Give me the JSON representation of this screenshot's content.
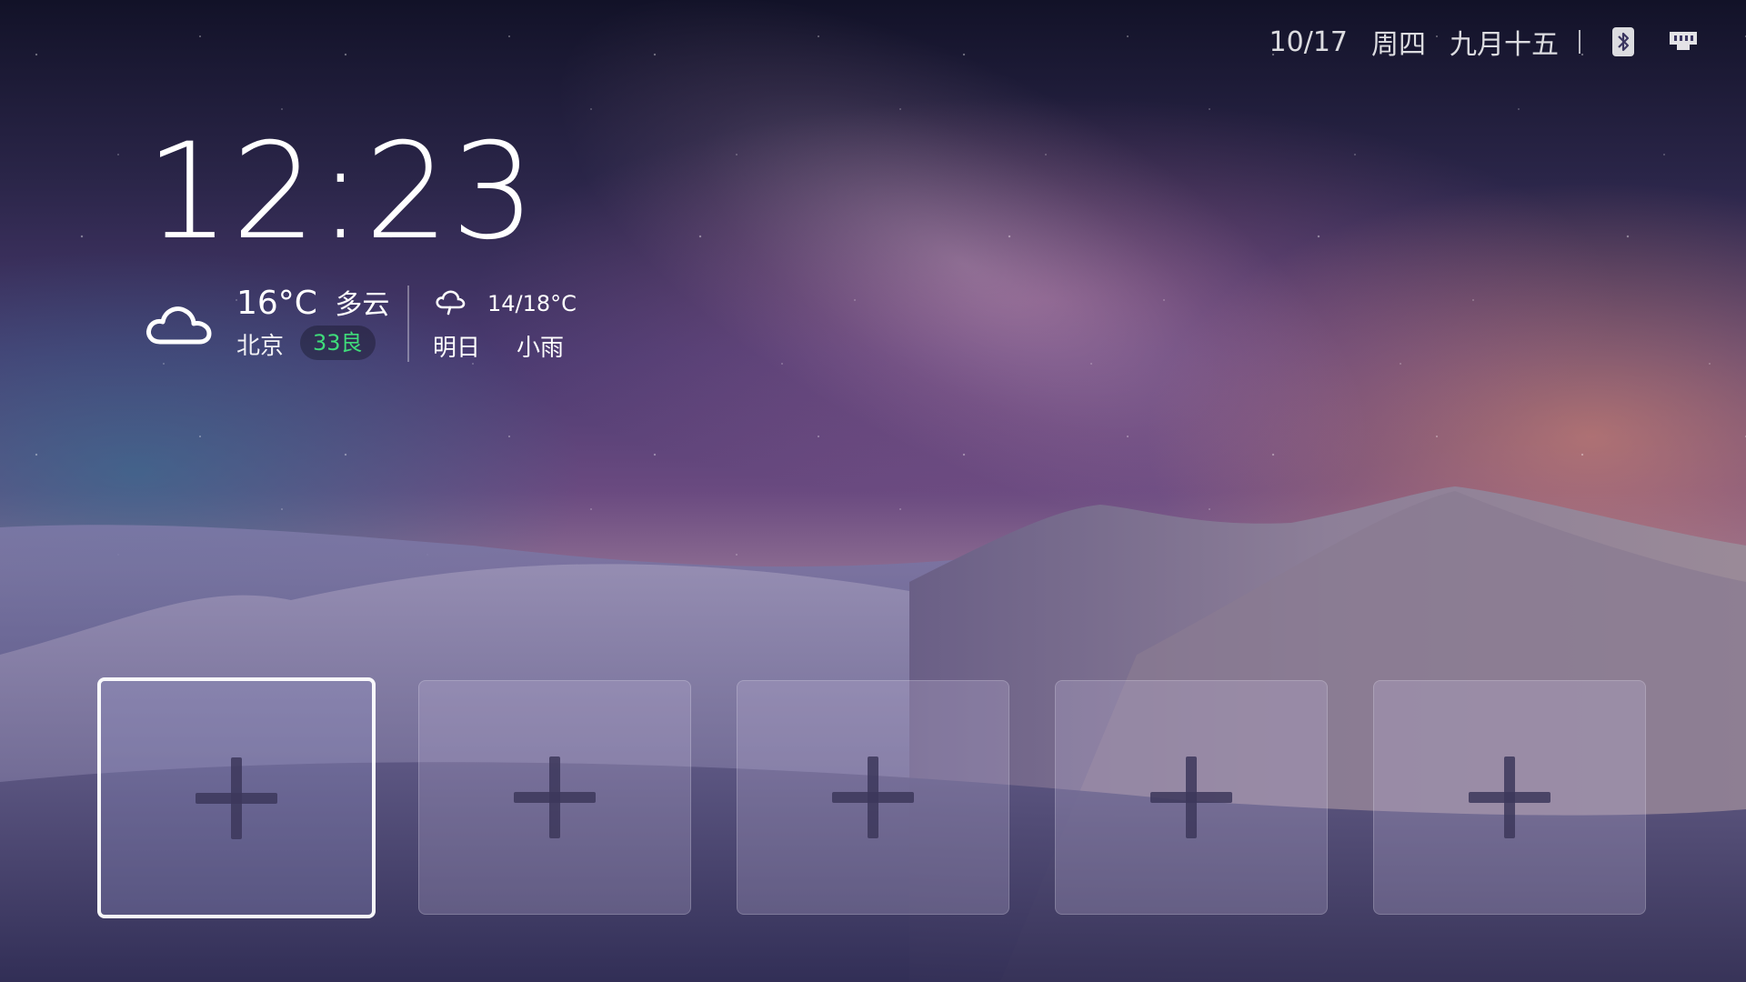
{
  "status_bar": {
    "date": "10/17",
    "weekday": "周四",
    "lunar_date": "九月十五",
    "bluetooth_icon": "bluetooth-icon",
    "network_icon": "ethernet-icon"
  },
  "clock": {
    "time": "12:23"
  },
  "weather": {
    "icon": "cloud-icon",
    "current_temp": "16°C",
    "condition": "多云",
    "city": "北京",
    "aqi": "33良",
    "aqi_color": "#3fdc7a",
    "tomorrow": {
      "icon": "rain-cloud-icon",
      "range": "14/18°C",
      "label": "明日",
      "condition": "小雨"
    }
  },
  "shortcuts": {
    "add_icon": "plus-icon",
    "slot_count": 5,
    "focused_index": 0
  }
}
